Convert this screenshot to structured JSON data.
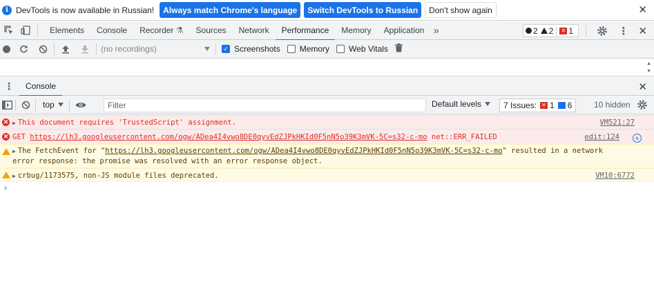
{
  "infobar": {
    "message": "DevTools is now available in Russian!",
    "btn_match": "Always match Chrome's language",
    "btn_switch": "Switch DevTools to Russian",
    "btn_dismiss": "Don't show again"
  },
  "tabs": [
    "Elements",
    "Console",
    "Recorder",
    "Sources",
    "Network",
    "Performance",
    "Memory",
    "Application"
  ],
  "active_tab": "Performance",
  "counters": {
    "errors_dot": "2",
    "warnings": "2",
    "issues_red": "1"
  },
  "perf_toolbar": {
    "recordings_placeholder": "(no recordings)",
    "screenshots_label": "Screenshots",
    "screenshots_checked": true,
    "memory_label": "Memory",
    "memory_checked": false,
    "webvitals_label": "Web Vitals",
    "webvitals_checked": false
  },
  "drawer": {
    "tab_label": "Console"
  },
  "console_toolbar": {
    "context": "top",
    "filter_placeholder": "Filter",
    "levels": "Default levels",
    "issues_label": "7 Issues:",
    "issues_errors": "1",
    "issues_info": "6",
    "hidden": "10 hidden"
  },
  "messages": [
    {
      "level": "error",
      "text": "This document requires 'TrustedScript' assignment.",
      "source": "VM521:27"
    },
    {
      "level": "error",
      "prefix": "GET ",
      "url": "https://lh3.googleusercontent.com/ogw/ADea4I4vwo8DE0qyvEdZJPkHKId0F5nN5o39K3mVK-5C=s32-c-mo",
      "suffix": " net::ERR_FAILED",
      "source": "edit:124"
    },
    {
      "level": "warning",
      "line1_prefix": "The FetchEvent for \"",
      "url": "https://lh3.googleusercontent.com/ogw/ADea4I4vwo8DE0qyvEdZJPkHKId0F5nN5o39K3mVK-5C=s32-c-mo",
      "line1_suffix": "\" resulted in a network",
      "line2": "error response: the promise was resolved with an error response object."
    },
    {
      "level": "warning",
      "text": "crbug/1173575, non-JS module files deprecated.",
      "source": "VM10:6772"
    }
  ]
}
